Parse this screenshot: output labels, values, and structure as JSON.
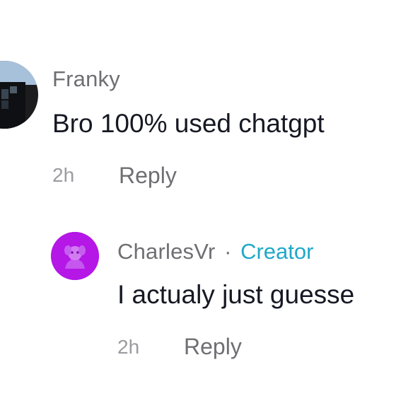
{
  "comments": [
    {
      "username": "Franky",
      "text": "Bro 100% used chatgpt",
      "time": "2h",
      "reply_label": "Reply"
    },
    {
      "username": "CharlesVr",
      "separator": "·",
      "badge": "Creator",
      "text": "I actualy just guesse",
      "time": "2h",
      "reply_label": "Reply"
    }
  ],
  "colors": {
    "username": "#6f6f73",
    "comment_text": "#161823",
    "meta": "#9b9ba0",
    "creator_badge": "#1fa8c9",
    "charles_avatar": "#b417e6"
  }
}
